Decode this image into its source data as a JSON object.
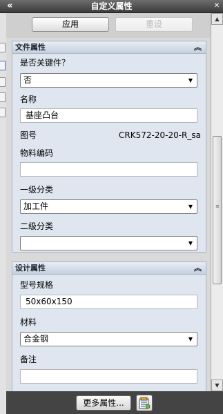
{
  "window": {
    "title": "自定义属性",
    "collapse_glyph": "«",
    "pin_glyph": "✕"
  },
  "toolbar": {
    "apply_label": "应用",
    "reset_label": "重设"
  },
  "file_properties": {
    "header": "文件属性",
    "is_key_part": {
      "label": "是否关键件？",
      "value": "否"
    },
    "name": {
      "label": "名称",
      "value": "基座凸台"
    },
    "drawing_no": {
      "label": "图号",
      "value": "CRK572-20-20-R_sa"
    },
    "material_code": {
      "label": "物料编码",
      "value": ""
    },
    "category_1": {
      "label": "一级分类",
      "value": "加工件"
    },
    "category_2": {
      "label": "二级分类",
      "value": ""
    }
  },
  "design_properties": {
    "header": "设计属性",
    "model_spec": {
      "label": "型号规格",
      "value": "50x60x150"
    },
    "material": {
      "label": "材料",
      "value": "合金钢"
    },
    "remark": {
      "label": "备注",
      "value": ""
    }
  },
  "footer": {
    "more_label": "更多属性..."
  },
  "icons": {
    "collapse_panel": "double-chevron-left-icon",
    "group_collapse": "double-chevron-up-icon",
    "dropdown": "dropdown-arrow-icon",
    "properties_sheet": "properties-sheet-icon"
  },
  "colors": {
    "title_bar": "#4a4a4a",
    "group_bg": "#dfe6ef",
    "group_header": "#c4d0de",
    "bottom_bar": "#444444"
  }
}
